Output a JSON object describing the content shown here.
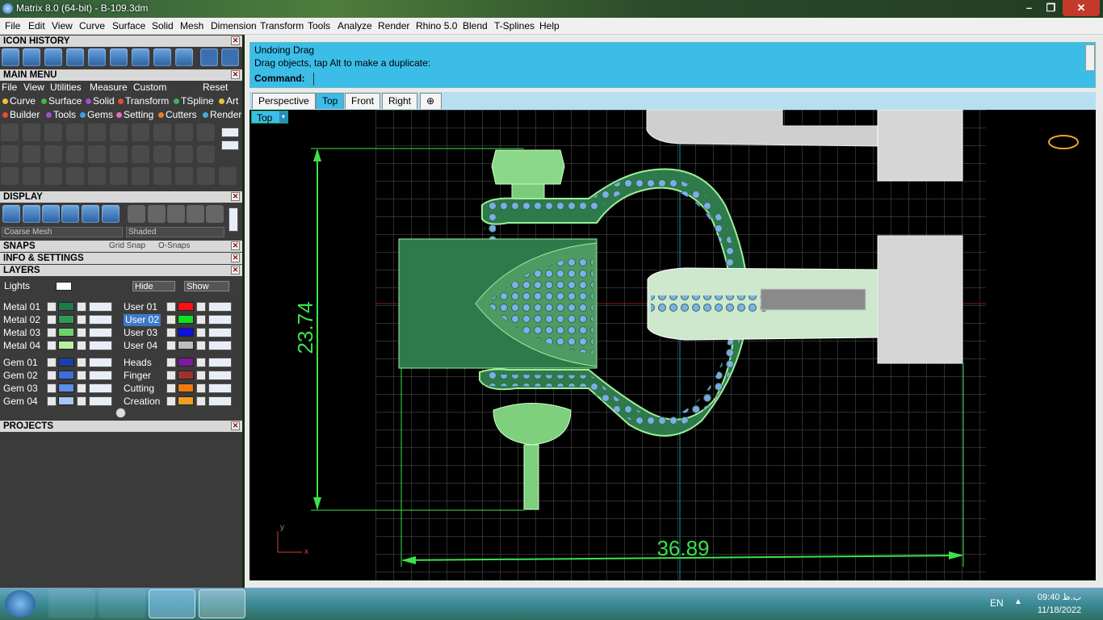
{
  "window": {
    "title": "Matrix 8.0 (64-bit) - B-109.3dm",
    "controls": [
      "–",
      "❒",
      "✕"
    ]
  },
  "menubar": [
    "File",
    "Edit",
    "View",
    "Curve",
    "Surface",
    "Solid",
    "Mesh",
    "Dimension",
    "Transform",
    "Tools",
    "Analyze",
    "Render",
    "Rhino 5.0",
    "Blend",
    "T-Splines",
    "Help"
  ],
  "panels": {
    "icon_history": "ICON HISTORY",
    "main_menu": "MAIN MENU",
    "display": "DISPLAY",
    "snaps": "SNAPS",
    "info": "INFO & SETTINGS",
    "layers": "LAYERS",
    "projects": "PROJECTS"
  },
  "main_menu": {
    "top": [
      "File",
      "View",
      "Utilities",
      "Measure",
      "Custom"
    ],
    "reset": "Reset",
    "row1": [
      {
        "label": "Curve",
        "color": "#e8c23a"
      },
      {
        "label": "Surface",
        "color": "#45b54a"
      },
      {
        "label": "Solid",
        "color": "#a050d0"
      },
      {
        "label": "Transform",
        "color": "#e05030"
      },
      {
        "label": "TSpline",
        "color": "#40b060"
      },
      {
        "label": "Art",
        "color": "#e8c23a"
      }
    ],
    "row2": [
      {
        "label": "Builder",
        "color": "#e05030"
      },
      {
        "label": "Tools",
        "color": "#a050d0"
      },
      {
        "label": "Gems",
        "color": "#40a0e0"
      },
      {
        "label": "Setting",
        "color": "#e070b0"
      },
      {
        "label": "Cutters",
        "color": "#e08030"
      },
      {
        "label": "Render",
        "color": "#40b0d0"
      }
    ]
  },
  "display": {
    "mesh": "Coarse Mesh",
    "shade": "Shaded"
  },
  "snaps": {
    "grid": "Grid Snap",
    "osnaps": "O-Snaps"
  },
  "layers": {
    "lights": "Lights",
    "hide": "Hide",
    "show": "Show",
    "left": [
      {
        "name": "Metal 01",
        "color": "#1a7a4a"
      },
      {
        "name": "Metal 02",
        "color": "#2e9a55"
      },
      {
        "name": "Metal 03",
        "color": "#6ad46a"
      },
      {
        "name": "Metal 04",
        "color": "#b8f0a0"
      },
      {
        "name": "Gem 01",
        "color": "#1a3fa8"
      },
      {
        "name": "Gem 02",
        "color": "#3f6ed8"
      },
      {
        "name": "Gem 03",
        "color": "#5d8ee8"
      },
      {
        "name": "Gem 04",
        "color": "#a6c6f4"
      }
    ],
    "right": [
      {
        "name": "User 01",
        "color": "#ff1010"
      },
      {
        "name": "User 02",
        "color": "#10e020"
      },
      {
        "name": "User 03",
        "color": "#1010e0"
      },
      {
        "name": "User 04",
        "color": "#bdbdbd"
      },
      {
        "name": "Heads",
        "color": "#7a1aa0"
      },
      {
        "name": "Finger",
        "color": "#a03030"
      },
      {
        "name": "Cutting",
        "color": "#f07a10"
      },
      {
        "name": "Creation",
        "color": "#f0a020"
      }
    ]
  },
  "command": {
    "line1": "Undoing Drag",
    "line2": "Drag objects, tap Alt to make a duplicate:",
    "label": "Command:"
  },
  "viewtabs": [
    "Perspective",
    "Top",
    "Front",
    "Right",
    "⊕"
  ],
  "viewport": {
    "label": "Top",
    "dim_vertical": "23.74",
    "dim_horizontal": "36.89",
    "axis_x": "x",
    "axis_y": "y"
  },
  "taskbar": {
    "lang": "EN",
    "time": "09:40 ب.ظ",
    "date": "11/18/2022"
  }
}
